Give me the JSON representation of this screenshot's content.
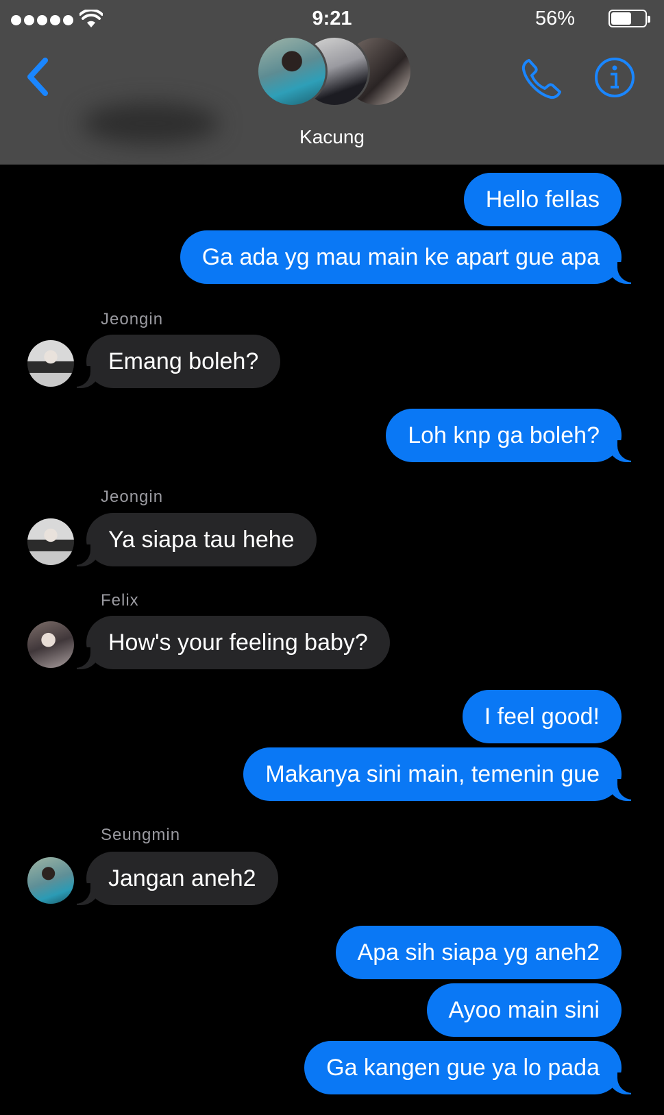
{
  "status_bar": {
    "time": "9:21",
    "battery_percent": "56%",
    "battery_level": 0.56
  },
  "header": {
    "group_name": "Kacung"
  },
  "icons": {
    "back": "chevron-left-icon",
    "call": "phone-icon",
    "info": "info-icon",
    "wifi": "wifi-icon",
    "battery": "battery-icon",
    "signal": "signal-dots-icon"
  },
  "colors": {
    "accent": "#0a78f5",
    "header_bg": "#4a4a4a",
    "incoming_bubble": "#262628",
    "background": "#000000"
  },
  "messages": [
    {
      "dir": "out",
      "text": "Hello fellas"
    },
    {
      "dir": "out",
      "text": "Ga ada yg mau main ke apart gue apa"
    },
    {
      "dir": "in",
      "sender": "Jeongin",
      "text": "Emang boleh?"
    },
    {
      "dir": "out",
      "text": "Loh knp ga boleh?"
    },
    {
      "dir": "in",
      "sender": "Jeongin",
      "text": "Ya siapa tau hehe"
    },
    {
      "dir": "in",
      "sender": "Felix",
      "text": "How's your feeling baby?"
    },
    {
      "dir": "out",
      "text": "I feel good!"
    },
    {
      "dir": "out",
      "text": "Makanya sini main, temenin gue"
    },
    {
      "dir": "in",
      "sender": "Seungmin",
      "text": "Jangan aneh2"
    },
    {
      "dir": "out",
      "text": "Apa sih siapa yg aneh2"
    },
    {
      "dir": "out",
      "text": "Ayoo main sini"
    },
    {
      "dir": "out",
      "text": "Ga kangen gue ya lo pada"
    }
  ]
}
